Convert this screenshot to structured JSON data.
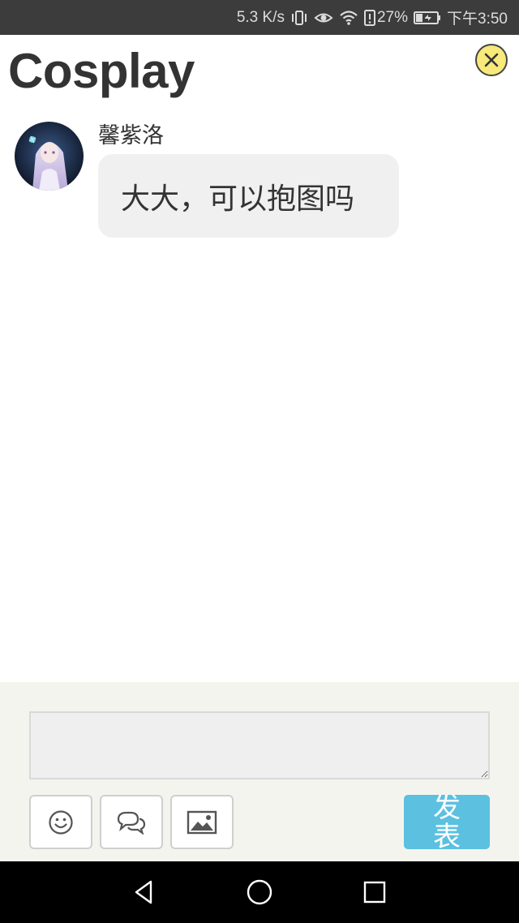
{
  "status_bar": {
    "speed": "5.3 K/s",
    "battery_percent": "27%",
    "time": "下午3:50",
    "icons": [
      "vibrate-icon",
      "eye-comfort-icon",
      "wifi-icon",
      "sim-alert-icon",
      "battery-icon"
    ]
  },
  "header": {
    "title": "Cosplay",
    "close_icon": "close-icon",
    "close_color": "#f7e97a"
  },
  "messages": [
    {
      "sender": "馨紫洛",
      "text": "大大，可以抱图吗"
    }
  ],
  "composer": {
    "input_value": "",
    "tools": [
      "emoji-icon",
      "chat-bubbles-icon",
      "image-icon"
    ],
    "send_label": "发表",
    "send_color": "#5cc0e0"
  },
  "nav_bar": {
    "buttons": [
      "back-icon",
      "home-icon",
      "recents-icon"
    ]
  }
}
